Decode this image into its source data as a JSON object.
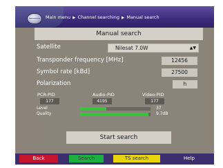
{
  "breadcrumb": {
    "main_menu": "Main menu",
    "channel_searching": "Channel searching",
    "manual_search": "Manual search",
    "separator": "▶"
  },
  "dialog": {
    "title": "Manual search",
    "satellite": {
      "label": "Satellite",
      "value": "Nilesat 7.0W",
      "arrow": "▲▼"
    },
    "transponder": {
      "label": "Transponder frequency [MHz]",
      "value": "12456"
    },
    "symbol_rate": {
      "label": "Symbol rate [kBd]",
      "value": "27500"
    },
    "polarization": {
      "label": "Polarization",
      "value": "h"
    },
    "pids": {
      "pcr": {
        "label": "PCR-PID",
        "value": "177"
      },
      "audio": {
        "label": "Audio-PID",
        "value": "4195"
      },
      "video": {
        "label": "Video-PID",
        "value": "177"
      }
    },
    "level": {
      "label": "Level",
      "value": "37",
      "fraction": 0.37
    },
    "quality": {
      "label": "Quality",
      "value": "9.7dB",
      "fraction": 0.97
    },
    "start_button": "Start search"
  },
  "function_keys": {
    "red": "Back",
    "green": "Search",
    "yellow": "TS search",
    "blue": "Help"
  },
  "colors": {
    "red": "#c8152e",
    "green": "#1bb03f",
    "yellow": "#e9d60a",
    "meter": "#35c43a",
    "topbar": "#3c2a7c"
  }
}
